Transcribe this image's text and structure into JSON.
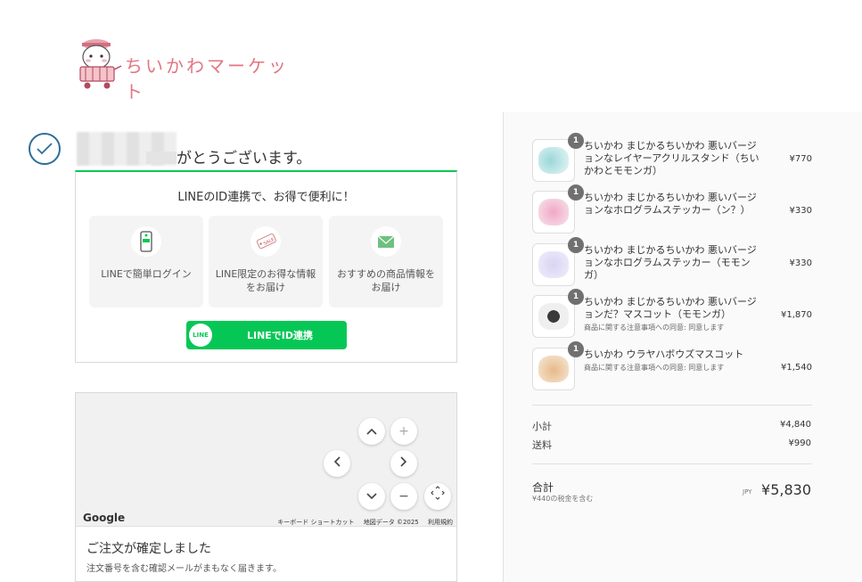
{
  "logo": {
    "text": "ちいかわマーケット"
  },
  "thanks": {
    "text": "がとうございます。"
  },
  "line_promo": {
    "title": "LINEのID連携で、お得で便利に！",
    "cards": [
      {
        "label": "LINEで簡単ログイン",
        "icon": "phone-icon"
      },
      {
        "label": "LINE限定のお得な情報をお届け",
        "icon": "sale-tag-icon"
      },
      {
        "label": "おすすめの商品情報をお届け",
        "icon": "mail-icon"
      }
    ],
    "button_icon_text": "LINE",
    "button_label": "LINEでID連携",
    "accent": "#06c755"
  },
  "map": {
    "google": "Google",
    "links": [
      "キーボード ショートカット",
      "地図データ ©2025",
      "利用規約"
    ],
    "controls": {
      "up": "^",
      "zoom_in": "+",
      "left": "<",
      "right": ">",
      "down": "v",
      "zoom_out": "−"
    }
  },
  "confirmation": {
    "title": "ご注文が確定しました",
    "subtitle": "注文番号を含む確認メールがまもなく届きます。"
  },
  "order": {
    "items": [
      {
        "qty": "1",
        "name": "ちいかわ まじかるちいかわ 悪いバージョンなレイヤーアクリルスタンド（ちいかわとモモンガ）",
        "price": "¥770",
        "note": ""
      },
      {
        "qty": "1",
        "name": "ちいかわ まじかるちいかわ 悪いバージョンなホログラムステッカー（ン？）",
        "price": "¥330",
        "note": ""
      },
      {
        "qty": "1",
        "name": "ちいかわ まじかるちいかわ 悪いバージョンなホログラムステッカー（モモンガ）",
        "price": "¥330",
        "note": ""
      },
      {
        "qty": "1",
        "name": "ちいかわ まじかるちいかわ 悪いバージョンだ？マスコット（モモンガ）",
        "price": "¥1,870",
        "note": "商品に関する注意事項への同意: 同意します"
      },
      {
        "qty": "1",
        "name": "ちいかわ ウラヤハボウズマスコット",
        "price": "¥1,540",
        "note": "商品に関する注意事項への同意: 同意します"
      }
    ],
    "subtotal_label": "小計",
    "subtotal": "¥4,840",
    "shipping_label": "送料",
    "shipping": "¥990",
    "total_label": "合計",
    "tax_note": "¥440の税金を含む",
    "currency": "JPY",
    "total": "¥5,830"
  }
}
